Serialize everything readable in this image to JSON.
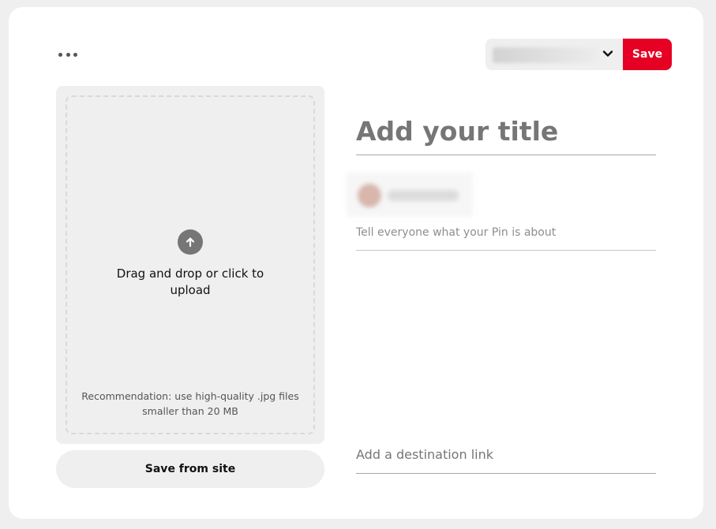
{
  "header": {
    "more_icon": "ellipsis-icon",
    "board_select_icon": "chevron-down-icon",
    "save_label": "Save"
  },
  "upload": {
    "icon": "arrow-up-circle-icon",
    "prompt": "Drag and drop or click to upload",
    "recommendation": "Recommendation: use high-quality .jpg files smaller than 20 MB",
    "save_from_site_label": "Save from site"
  },
  "form": {
    "title_placeholder": "Add your title",
    "description_placeholder": "Tell everyone what your Pin is about",
    "link_placeholder": "Add a destination link"
  },
  "colors": {
    "accent": "#e60023",
    "panel": "#efefef",
    "background": "#efefef"
  }
}
